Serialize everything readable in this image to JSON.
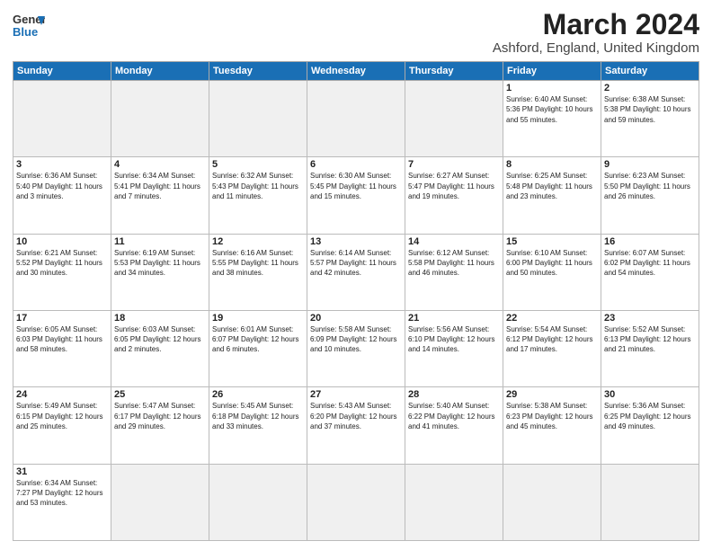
{
  "header": {
    "logo_line1": "General",
    "logo_line2": "Blue",
    "month_year": "March 2024",
    "location": "Ashford, England, United Kingdom"
  },
  "days_of_week": [
    "Sunday",
    "Monday",
    "Tuesday",
    "Wednesday",
    "Thursday",
    "Friday",
    "Saturday"
  ],
  "weeks": [
    [
      {
        "num": "",
        "info": "",
        "empty": true
      },
      {
        "num": "",
        "info": "",
        "empty": true
      },
      {
        "num": "",
        "info": "",
        "empty": true
      },
      {
        "num": "",
        "info": "",
        "empty": true
      },
      {
        "num": "",
        "info": "",
        "empty": true
      },
      {
        "num": "1",
        "info": "Sunrise: 6:40 AM\nSunset: 5:36 PM\nDaylight: 10 hours\nand 55 minutes."
      },
      {
        "num": "2",
        "info": "Sunrise: 6:38 AM\nSunset: 5:38 PM\nDaylight: 10 hours\nand 59 minutes."
      }
    ],
    [
      {
        "num": "3",
        "info": "Sunrise: 6:36 AM\nSunset: 5:40 PM\nDaylight: 11 hours\nand 3 minutes."
      },
      {
        "num": "4",
        "info": "Sunrise: 6:34 AM\nSunset: 5:41 PM\nDaylight: 11 hours\nand 7 minutes."
      },
      {
        "num": "5",
        "info": "Sunrise: 6:32 AM\nSunset: 5:43 PM\nDaylight: 11 hours\nand 11 minutes."
      },
      {
        "num": "6",
        "info": "Sunrise: 6:30 AM\nSunset: 5:45 PM\nDaylight: 11 hours\nand 15 minutes."
      },
      {
        "num": "7",
        "info": "Sunrise: 6:27 AM\nSunset: 5:47 PM\nDaylight: 11 hours\nand 19 minutes."
      },
      {
        "num": "8",
        "info": "Sunrise: 6:25 AM\nSunset: 5:48 PM\nDaylight: 11 hours\nand 23 minutes."
      },
      {
        "num": "9",
        "info": "Sunrise: 6:23 AM\nSunset: 5:50 PM\nDaylight: 11 hours\nand 26 minutes."
      }
    ],
    [
      {
        "num": "10",
        "info": "Sunrise: 6:21 AM\nSunset: 5:52 PM\nDaylight: 11 hours\nand 30 minutes."
      },
      {
        "num": "11",
        "info": "Sunrise: 6:19 AM\nSunset: 5:53 PM\nDaylight: 11 hours\nand 34 minutes."
      },
      {
        "num": "12",
        "info": "Sunrise: 6:16 AM\nSunset: 5:55 PM\nDaylight: 11 hours\nand 38 minutes."
      },
      {
        "num": "13",
        "info": "Sunrise: 6:14 AM\nSunset: 5:57 PM\nDaylight: 11 hours\nand 42 minutes."
      },
      {
        "num": "14",
        "info": "Sunrise: 6:12 AM\nSunset: 5:58 PM\nDaylight: 11 hours\nand 46 minutes."
      },
      {
        "num": "15",
        "info": "Sunrise: 6:10 AM\nSunset: 6:00 PM\nDaylight: 11 hours\nand 50 minutes."
      },
      {
        "num": "16",
        "info": "Sunrise: 6:07 AM\nSunset: 6:02 PM\nDaylight: 11 hours\nand 54 minutes."
      }
    ],
    [
      {
        "num": "17",
        "info": "Sunrise: 6:05 AM\nSunset: 6:03 PM\nDaylight: 11 hours\nand 58 minutes."
      },
      {
        "num": "18",
        "info": "Sunrise: 6:03 AM\nSunset: 6:05 PM\nDaylight: 12 hours\nand 2 minutes."
      },
      {
        "num": "19",
        "info": "Sunrise: 6:01 AM\nSunset: 6:07 PM\nDaylight: 12 hours\nand 6 minutes."
      },
      {
        "num": "20",
        "info": "Sunrise: 5:58 AM\nSunset: 6:09 PM\nDaylight: 12 hours\nand 10 minutes."
      },
      {
        "num": "21",
        "info": "Sunrise: 5:56 AM\nSunset: 6:10 PM\nDaylight: 12 hours\nand 14 minutes."
      },
      {
        "num": "22",
        "info": "Sunrise: 5:54 AM\nSunset: 6:12 PM\nDaylight: 12 hours\nand 17 minutes."
      },
      {
        "num": "23",
        "info": "Sunrise: 5:52 AM\nSunset: 6:13 PM\nDaylight: 12 hours\nand 21 minutes."
      }
    ],
    [
      {
        "num": "24",
        "info": "Sunrise: 5:49 AM\nSunset: 6:15 PM\nDaylight: 12 hours\nand 25 minutes."
      },
      {
        "num": "25",
        "info": "Sunrise: 5:47 AM\nSunset: 6:17 PM\nDaylight: 12 hours\nand 29 minutes."
      },
      {
        "num": "26",
        "info": "Sunrise: 5:45 AM\nSunset: 6:18 PM\nDaylight: 12 hours\nand 33 minutes."
      },
      {
        "num": "27",
        "info": "Sunrise: 5:43 AM\nSunset: 6:20 PM\nDaylight: 12 hours\nand 37 minutes."
      },
      {
        "num": "28",
        "info": "Sunrise: 5:40 AM\nSunset: 6:22 PM\nDaylight: 12 hours\nand 41 minutes."
      },
      {
        "num": "29",
        "info": "Sunrise: 5:38 AM\nSunset: 6:23 PM\nDaylight: 12 hours\nand 45 minutes."
      },
      {
        "num": "30",
        "info": "Sunrise: 5:36 AM\nSunset: 6:25 PM\nDaylight: 12 hours\nand 49 minutes."
      }
    ],
    [
      {
        "num": "31",
        "info": "Sunrise: 6:34 AM\nSunset: 7:27 PM\nDaylight: 12 hours\nand 53 minutes."
      },
      {
        "num": "",
        "info": "",
        "empty": true
      },
      {
        "num": "",
        "info": "",
        "empty": true
      },
      {
        "num": "",
        "info": "",
        "empty": true
      },
      {
        "num": "",
        "info": "",
        "empty": true
      },
      {
        "num": "",
        "info": "",
        "empty": true
      },
      {
        "num": "",
        "info": "",
        "empty": true
      }
    ]
  ]
}
